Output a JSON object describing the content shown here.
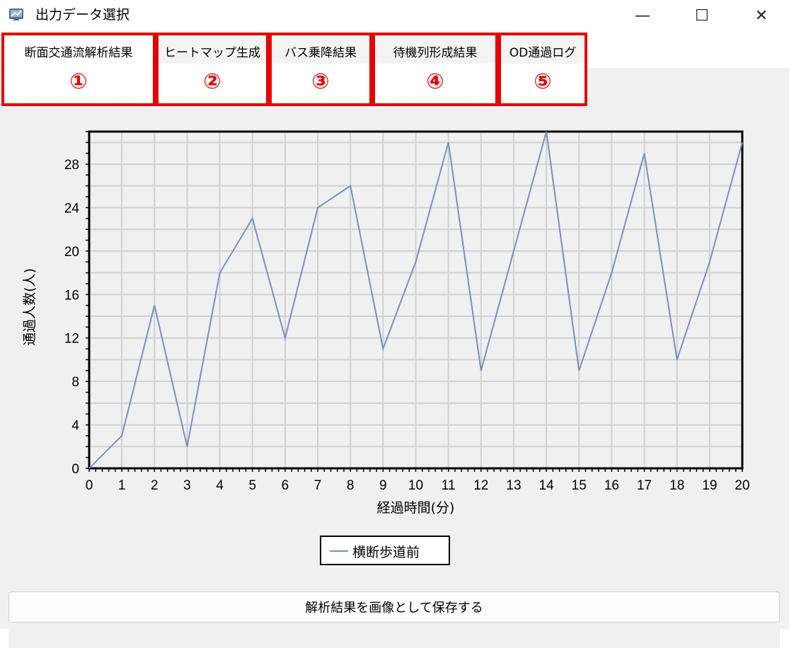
{
  "window": {
    "title": "出力データ選択",
    "minimize_glyph": "—",
    "maximize_glyph": "☐",
    "close_glyph": "✕"
  },
  "tabs": [
    {
      "label": "断面交通流解析結果",
      "marker": "①",
      "active": true
    },
    {
      "label": "ヒートマップ生成",
      "marker": "②",
      "active": false
    },
    {
      "label": "バス乗降結果",
      "marker": "③",
      "active": false
    },
    {
      "label": "待機列形成結果",
      "marker": "④",
      "active": false
    },
    {
      "label": "OD通過ログ",
      "marker": "⑤",
      "active": false
    }
  ],
  "colors": {
    "highlight": "#e60000",
    "series": "#7a8fbf",
    "grid": "#d0d0d0",
    "plot_bg": "#f0f0f0"
  },
  "chart_data": {
    "type": "line",
    "title": "",
    "xlabel": "経過時間(分)",
    "ylabel": "通過人数(人)",
    "x": [
      0,
      1,
      2,
      3,
      4,
      5,
      6,
      7,
      8,
      9,
      10,
      11,
      12,
      13,
      14,
      15,
      16,
      17,
      18,
      19,
      20
    ],
    "xlim": [
      0,
      20
    ],
    "ylim": [
      0,
      31
    ],
    "yticks": [
      0,
      4,
      8,
      12,
      16,
      20,
      24,
      28
    ],
    "xticks": [
      0,
      1,
      2,
      3,
      4,
      5,
      6,
      7,
      8,
      9,
      10,
      11,
      12,
      13,
      14,
      15,
      16,
      17,
      18,
      19,
      20
    ],
    "grid": true,
    "legend_position": "bottom-center",
    "series": [
      {
        "name": "横断歩道前",
        "values": [
          0,
          3,
          15,
          2,
          18,
          23,
          12,
          24,
          26,
          11,
          19,
          30,
          9,
          20,
          31,
          9,
          18,
          29,
          10,
          19,
          30
        ]
      }
    ]
  },
  "save_button": {
    "label": "解析結果を画像として保存する"
  }
}
